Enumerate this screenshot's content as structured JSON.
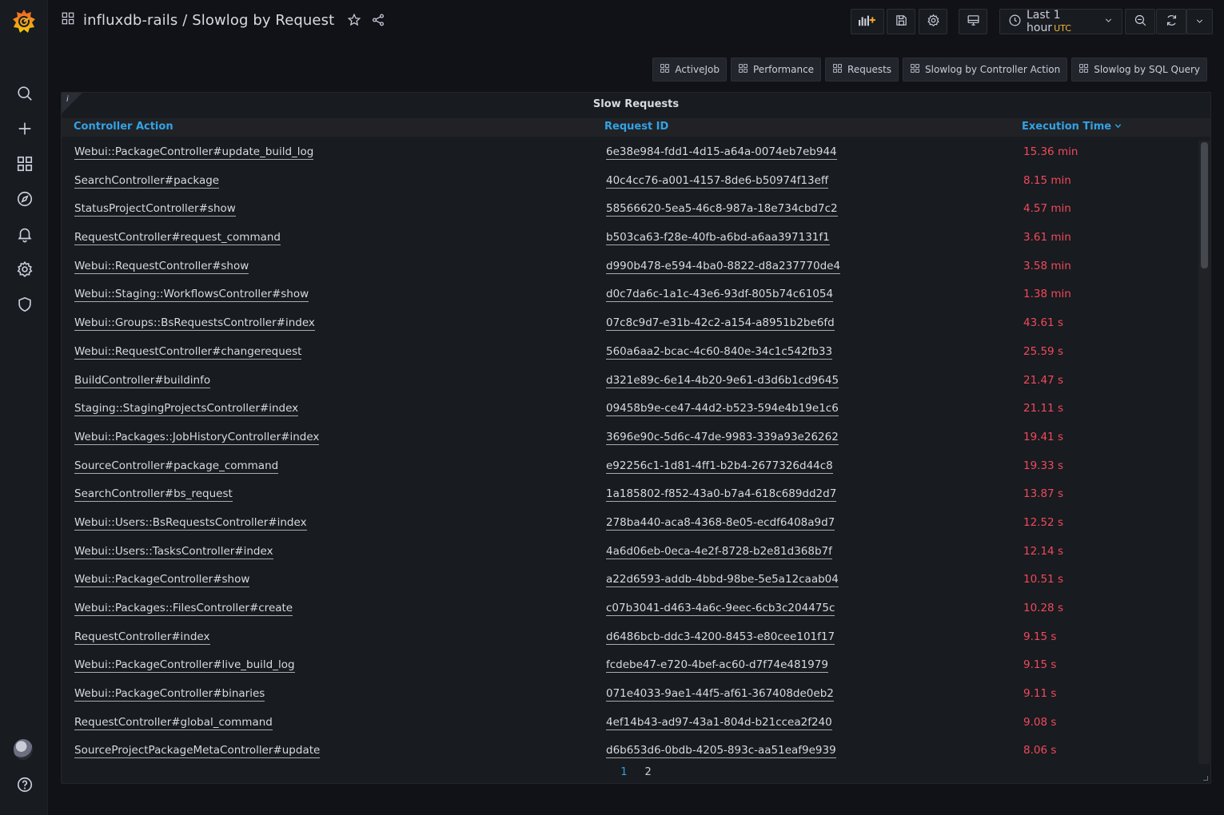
{
  "header": {
    "folder": "influxdb-rails",
    "separator": "/",
    "dashboard": "Slowlog by Request"
  },
  "time_picker": {
    "label": "Last 1 hour",
    "timezone": "UTC"
  },
  "links": [
    "ActiveJob",
    "Performance",
    "Requests",
    "Slowlog by Controller Action",
    "Slowlog by SQL Query"
  ],
  "panel": {
    "title": "Slow Requests",
    "info": "i",
    "columns": [
      "Controller Action",
      "Request ID",
      "Execution Time"
    ],
    "sort_column": "Execution Time",
    "rows": [
      {
        "action": "Webui::PackageController#update_build_log",
        "request_id": "6e38e984-fdd1-4d15-a64a-0074eb7eb944",
        "time": "15.36 min"
      },
      {
        "action": "SearchController#package",
        "request_id": "40c4cc76-a001-4157-8de6-b50974f13eff",
        "time": "8.15 min"
      },
      {
        "action": "StatusProjectController#show",
        "request_id": "58566620-5ea5-46c8-987a-18e734cbd7c2",
        "time": "4.57 min"
      },
      {
        "action": "RequestController#request_command",
        "request_id": "b503ca63-f28e-40fb-a6bd-a6aa397131f1",
        "time": "3.61 min"
      },
      {
        "action": "Webui::RequestController#show",
        "request_id": "d990b478-e594-4ba0-8822-d8a237770de4",
        "time": "3.58 min"
      },
      {
        "action": "Webui::Staging::WorkflowsController#show",
        "request_id": "d0c7da6c-1a1c-43e6-93df-805b74c61054",
        "time": "1.38 min"
      },
      {
        "action": "Webui::Groups::BsRequestsController#index",
        "request_id": "07c8c9d7-e31b-42c2-a154-a8951b2be6fd",
        "time": "43.61 s"
      },
      {
        "action": "Webui::RequestController#changerequest",
        "request_id": "560a6aa2-bcac-4c60-840e-34c1c542fb33",
        "time": "25.59 s"
      },
      {
        "action": "BuildController#buildinfo",
        "request_id": "d321e89c-6e14-4b20-9e61-d3d6b1cd9645",
        "time": "21.47 s"
      },
      {
        "action": "Staging::StagingProjectsController#index",
        "request_id": "09458b9e-ce47-44d2-b523-594e4b19e1c6",
        "time": "21.11 s"
      },
      {
        "action": "Webui::Packages::JobHistoryController#index",
        "request_id": "3696e90c-5d6c-47de-9983-339a93e26262",
        "time": "19.41 s"
      },
      {
        "action": "SourceController#package_command",
        "request_id": "e92256c1-1d81-4ff1-b2b4-2677326d44c8",
        "time": "19.33 s"
      },
      {
        "action": "SearchController#bs_request",
        "request_id": "1a185802-f852-43a0-b7a4-618c689dd2d7",
        "time": "13.87 s"
      },
      {
        "action": "Webui::Users::BsRequestsController#index",
        "request_id": "278ba440-aca8-4368-8e05-ecdf6408a9d7",
        "time": "12.52 s"
      },
      {
        "action": "Webui::Users::TasksController#index",
        "request_id": "4a6d06eb-0eca-4e2f-8728-b2e81d368b7f",
        "time": "12.14 s"
      },
      {
        "action": "Webui::PackageController#show",
        "request_id": "a22d6593-addb-4bbd-98be-5e5a12caab04",
        "time": "10.51 s"
      },
      {
        "action": "Webui::Packages::FilesController#create",
        "request_id": "c07b3041-d463-4a6c-9eec-6cb3c204475c",
        "time": "10.28 s"
      },
      {
        "action": "RequestController#index",
        "request_id": "d6486bcb-ddc3-4200-8453-e80cee101f17",
        "time": "9.15 s"
      },
      {
        "action": "Webui::PackageController#live_build_log",
        "request_id": "fcdebe47-e720-4bef-ac60-d7f74e481979",
        "time": "9.15 s"
      },
      {
        "action": "Webui::PackageController#binaries",
        "request_id": "071e4033-9ae1-44f5-af61-367408de0eb2",
        "time": "9.11 s"
      },
      {
        "action": "RequestController#global_command",
        "request_id": "4ef14b43-ad97-43a1-804d-b21ccea2f240",
        "time": "9.08 s"
      },
      {
        "action": "SourceProjectPackageMetaController#update",
        "request_id": "d6b653d6-0bdb-4205-893c-aa51eaf9e939",
        "time": "8.06 s"
      }
    ],
    "pages": [
      "1",
      "2"
    ],
    "current_page": "1"
  },
  "colors": {
    "accent": "#33a2e5",
    "time_value": "#f2495c",
    "timezone": "#f5b73b",
    "background": "#111217",
    "panel": "#181b1f"
  },
  "icons": {
    "sidebar": [
      "grafana-logo-icon",
      "search-icon",
      "plus-icon",
      "dashboards-icon",
      "explore-compass-icon",
      "alerting-bell-icon",
      "gear-icon",
      "shield-icon",
      "help-icon"
    ],
    "toolbar": [
      "add-panel-icon",
      "save-icon",
      "settings-icon",
      "tv-mode-icon",
      "clock-icon",
      "zoom-out-icon",
      "refresh-icon",
      "chevron-down-icon"
    ]
  }
}
